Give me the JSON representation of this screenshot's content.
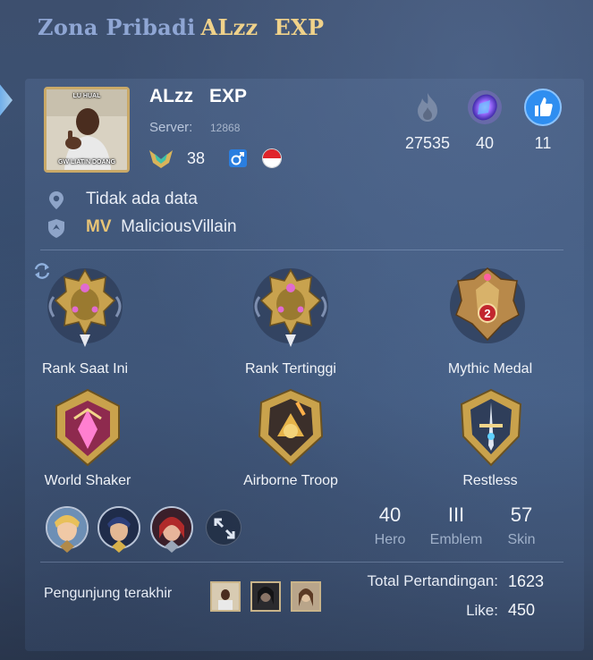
{
  "header": {
    "title_prefix": "Zona Pribadi",
    "title_name": "ALzz",
    "title_squad": "EXP"
  },
  "profile": {
    "avatar_caption_top": "LU HUAL",
    "avatar_caption_bottom": "GW LIATIN DOANG",
    "name": "ALzz",
    "squad": "EXP",
    "server_label": "Server:",
    "server_value": "12868",
    "level": "38",
    "gender_icon": "male-icon",
    "country_flag": "indonesia-flag-icon"
  },
  "stats": [
    {
      "icon": "flame-icon",
      "value": "27535"
    },
    {
      "icon": "purple-gem-icon",
      "value": "40"
    },
    {
      "icon": "thumbs-up-icon",
      "value": "11"
    }
  ],
  "info": {
    "location": "Tidak ada data",
    "squad_tag": "MV",
    "squad_name": "MaliciousVillain"
  },
  "medals": [
    {
      "label": "Rank Saat Ini",
      "kind": "mythic-rank-badge"
    },
    {
      "label": "Rank Tertinggi",
      "kind": "mythic-rank-badge"
    },
    {
      "label": "Mythic Medal",
      "kind": "mythic-medal-badge",
      "number": "2"
    },
    {
      "label": "World Shaker",
      "kind": "achievement-badge"
    },
    {
      "label": "Airborne Troop",
      "kind": "achievement-badge"
    },
    {
      "label": "Restless",
      "kind": "achievement-badge"
    }
  ],
  "counts": [
    {
      "value": "40",
      "label": "Hero"
    },
    {
      "value": "III",
      "label": "Emblem"
    },
    {
      "value": "57",
      "label": "Skin"
    }
  ],
  "footer": {
    "visitors_label": "Pengunjung terakhir",
    "total_matches_label": "Total Pertandingan:",
    "total_matches_value": "1623",
    "like_label": "Like:",
    "like_value": "450"
  },
  "colors": {
    "accent_gold": "#f0d28a",
    "title_blue": "#8fa6d4",
    "squad_tag": "#e8c476",
    "like_blue": "#2f8ef0"
  }
}
